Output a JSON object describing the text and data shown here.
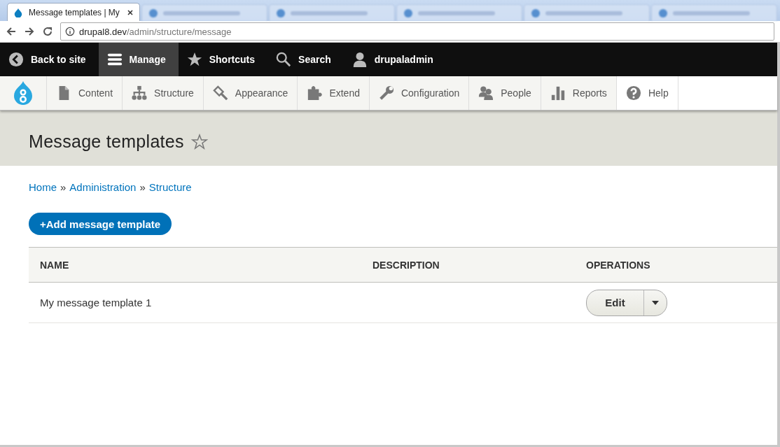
{
  "browser": {
    "tab": {
      "title": "Message templates | My",
      "selected": true
    },
    "address": {
      "host": "drupal8.dev",
      "path": "/admin/structure/message"
    }
  },
  "toolbar": {
    "items": [
      {
        "label": "Back to site",
        "kind": "back",
        "selected": false
      },
      {
        "label": "Manage",
        "kind": "menu",
        "selected": true
      },
      {
        "label": "Shortcuts",
        "kind": "star",
        "selected": false
      },
      {
        "label": "Search",
        "kind": "search",
        "selected": false
      },
      {
        "label": "drupaladmin",
        "kind": "user",
        "selected": false
      }
    ]
  },
  "tray": {
    "items": [
      {
        "label": "Content",
        "kind": "content",
        "selected": false
      },
      {
        "label": "Structure",
        "kind": "structure",
        "selected": false
      },
      {
        "label": "Appearance",
        "kind": "appearance",
        "selected": false
      },
      {
        "label": "Extend",
        "kind": "extend",
        "selected": false
      },
      {
        "label": "Configuration",
        "kind": "configuration",
        "selected": false
      },
      {
        "label": "People",
        "kind": "people",
        "selected": false
      },
      {
        "label": "Reports",
        "kind": "reports",
        "selected": false
      },
      {
        "label": "Help",
        "kind": "help",
        "selected": true
      }
    ]
  },
  "page": {
    "title": "Message templates",
    "breadcrumb": {
      "separator": "»",
      "items": [
        "Home",
        "Administration",
        "Structure"
      ]
    },
    "action": "+Add message template",
    "table": {
      "columns": [
        "NAME",
        "DESCRIPTION",
        "OPERATIONS"
      ],
      "rows": [
        {
          "name": "My message template 1",
          "operation": "Edit"
        }
      ]
    }
  }
}
